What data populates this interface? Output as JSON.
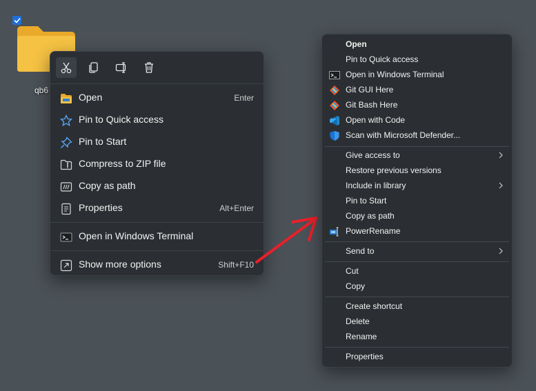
{
  "desktop": {
    "folder_label": "qb6"
  },
  "modern_menu": {
    "toolbar": [
      {
        "icon": "cut-icon"
      },
      {
        "icon": "copy-icon"
      },
      {
        "icon": "rename-icon"
      },
      {
        "icon": "delete-icon"
      }
    ],
    "items": [
      {
        "label": "Open",
        "shortcut": "Enter",
        "icon": "folder-open-icon"
      },
      {
        "label": "Pin to Quick access",
        "shortcut": "",
        "icon": "star-icon"
      },
      {
        "label": "Pin to Start",
        "shortcut": "",
        "icon": "pin-icon"
      },
      {
        "label": "Compress to ZIP file",
        "shortcut": "",
        "icon": "zip-icon"
      },
      {
        "label": "Copy as path",
        "shortcut": "",
        "icon": "copy-path-icon"
      },
      {
        "label": "Properties",
        "shortcut": "Alt+Enter",
        "icon": "properties-icon"
      },
      {
        "label": "Open in Windows Terminal",
        "shortcut": "",
        "icon": "terminal-icon"
      },
      {
        "label": "Show more options",
        "shortcut": "Shift+F10",
        "icon": "more-options-icon"
      }
    ]
  },
  "classic_menu": {
    "items": [
      {
        "label": "Open"
      },
      {
        "label": "Pin to Quick access"
      },
      {
        "label": "Open in Windows Terminal",
        "icon": "terminal-icon"
      },
      {
        "label": "Git GUI Here",
        "icon": "git-icon"
      },
      {
        "label": "Git Bash Here",
        "icon": "git-icon"
      },
      {
        "label": "Open with Code",
        "icon": "vscode-icon"
      },
      {
        "label": "Scan with Microsoft Defender...",
        "icon": "defender-shield-icon"
      },
      {
        "label": "Give access to",
        "submenu": true
      },
      {
        "label": "Restore previous versions"
      },
      {
        "label": "Include in library",
        "submenu": true
      },
      {
        "label": "Pin to Start"
      },
      {
        "label": "Copy as path"
      },
      {
        "label": "PowerRename",
        "icon": "powerrename-icon"
      },
      {
        "label": "Send to",
        "submenu": true
      },
      {
        "label": "Cut"
      },
      {
        "label": "Copy"
      },
      {
        "label": "Create shortcut"
      },
      {
        "label": "Delete"
      },
      {
        "label": "Rename"
      },
      {
        "label": "Properties"
      }
    ]
  },
  "colors": {
    "desktop_bg": "#4a5157",
    "menu_bg": "#2b2f33",
    "accent_arrow": "#e8202a",
    "folder_yellow": "#f5c243"
  }
}
